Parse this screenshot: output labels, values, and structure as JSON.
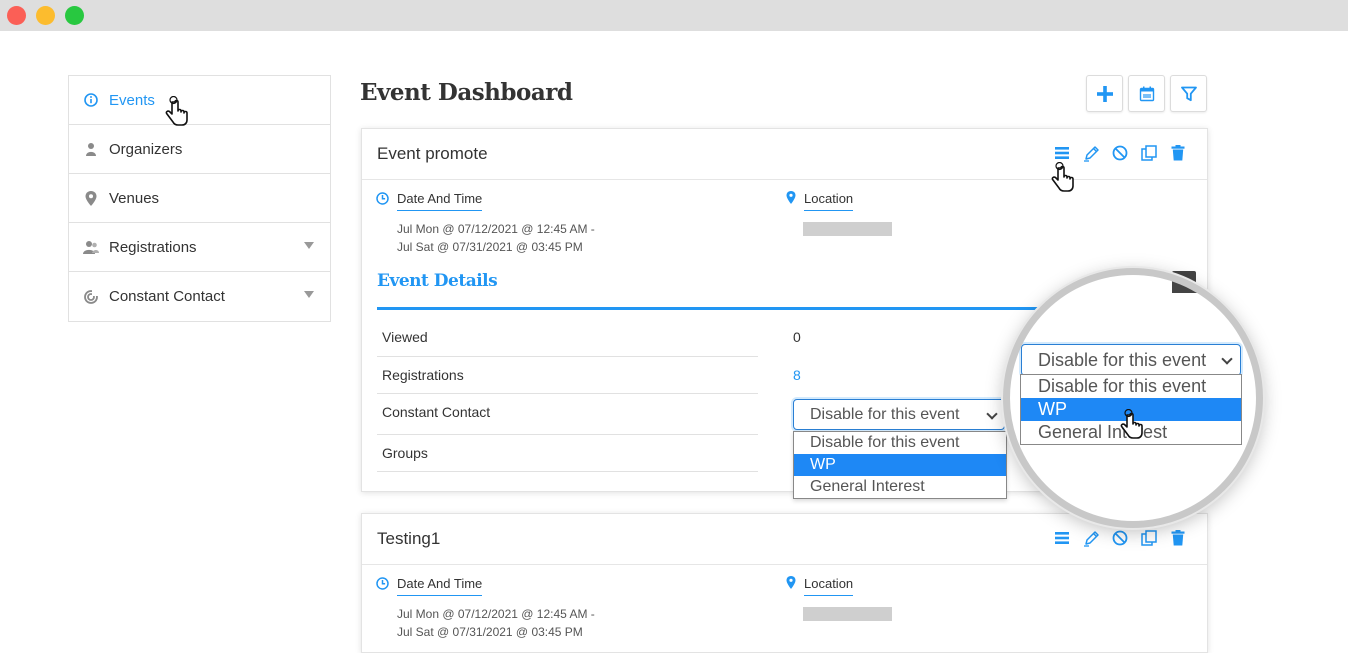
{
  "sidebar": {
    "items": [
      {
        "label": "Events",
        "icon": "info-icon"
      },
      {
        "label": "Organizers",
        "icon": "user-icon"
      },
      {
        "label": "Venues",
        "icon": "pin-icon"
      },
      {
        "label": "Registrations",
        "icon": "users-icon"
      },
      {
        "label": "Constant Contact",
        "icon": "constant-contact-icon"
      }
    ]
  },
  "page": {
    "title": "Event Dashboard"
  },
  "events": [
    {
      "title": "Event promote",
      "date_label": "Date And Time",
      "date_line1": "Jul Mon @ 07/12/2021 @ 12:45 AM -",
      "date_line2": "Jul Sat @ 07/31/2021 @ 03:45 PM",
      "location_label": "Location",
      "details_title": "Event Details",
      "rows": {
        "viewed_label": "Viewed",
        "viewed_value": "0",
        "registrations_label": "Registrations",
        "registrations_value": "8",
        "cc_label": "Constant Contact",
        "groups_label": "Groups"
      },
      "select": {
        "value": "Disable for this event",
        "options": [
          "Disable for this event",
          "WP",
          "General Interest"
        ]
      }
    },
    {
      "title": "Testing1",
      "date_label": "Date And Time",
      "date_line1": "Jul Mon @ 07/12/2021 @ 12:45 AM -",
      "date_line2": "Jul Sat @ 07/31/2021 @ 03:45 PM",
      "location_label": "Location"
    }
  ],
  "colors": {
    "accent": "#2196f3",
    "option_selected": "#1e88f5",
    "trash": "#2196f3"
  }
}
